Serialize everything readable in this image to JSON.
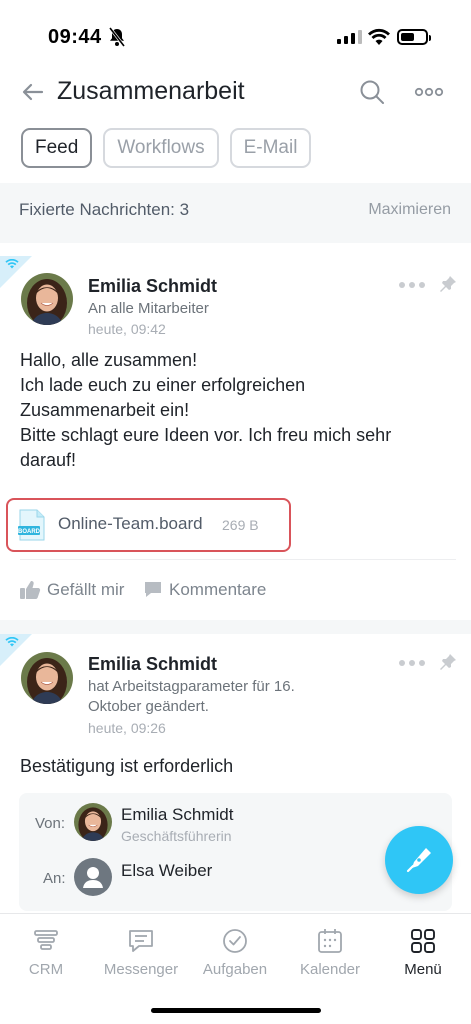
{
  "status_bar": {
    "time": "09:44"
  },
  "header": {
    "title": "Zusammenarbeit"
  },
  "tabs": [
    {
      "label": "Feed"
    },
    {
      "label": "Workflows"
    },
    {
      "label": "E-Mail"
    }
  ],
  "pinned": {
    "label": "Fixierte Nachrichten: 3",
    "maximize": "Maximieren"
  },
  "posts": [
    {
      "author": "Emilia Schmidt",
      "destination": "An alle Mitarbeiter",
      "time": "heute, 09:42",
      "lines": [
        "Hallo, alle zusammen!",
        "Ich lade euch zu einer erfolgreichen",
        "Zusammenarbeit ein!",
        "Bitte schlagt eure Ideen vor. Ich freu mich sehr",
        "darauf!"
      ],
      "attachment": {
        "name": "Online-Team.board",
        "size": "269 B",
        "icon_label": "BOARD"
      },
      "like_label": "Gefällt mir",
      "comments_label": "Kommentare"
    },
    {
      "author": "Emilia Schmidt",
      "destination_line1": "hat Arbeitstagparameter für 16.",
      "destination_line2": "Oktober geändert.",
      "time": "heute, 09:26",
      "confirm_text": "Bestätigung ist erforderlich",
      "from_label": "Von:",
      "from_name": "Emilia Schmidt",
      "from_role": "Geschäftsführerin",
      "to_label": "An:",
      "to_name": "Elsa Weiber"
    }
  ],
  "nav": [
    {
      "label": "CRM",
      "icon": "crm-icon"
    },
    {
      "label": "Messenger",
      "icon": "messenger-icon"
    },
    {
      "label": "Aufgaben",
      "icon": "tasks-icon"
    },
    {
      "label": "Kalender",
      "icon": "calendar-icon"
    },
    {
      "label": "Menü",
      "icon": "menu-grid-icon",
      "active": true
    }
  ],
  "colors": {
    "accent": "#2fc6f6",
    "highlight_border": "#d9545a",
    "muted_bg": "#f5f7f8"
  }
}
